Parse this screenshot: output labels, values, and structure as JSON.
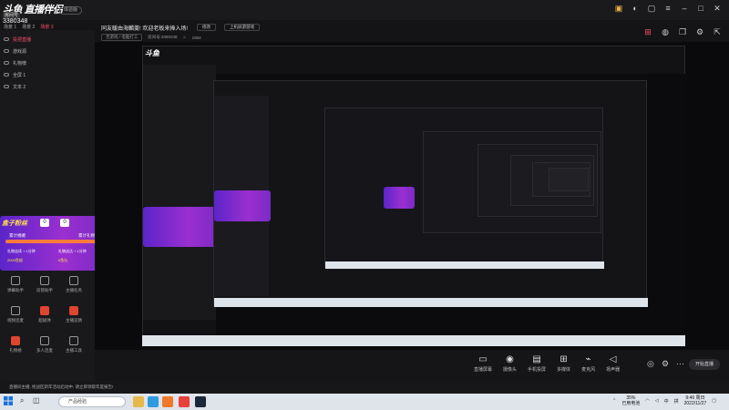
{
  "app": {
    "logo": "斗鱼 直播伴侣",
    "badge": "体验版",
    "room_id_tag": "房间号",
    "room_id": "3380348"
  },
  "scenes": [
    "场景 1",
    "场景 2",
    "场景 3"
  ],
  "active_scene": 2,
  "room": {
    "title": "同友暖由海麟羹! 欢迎老板来捧入场!",
    "edit_btn": "修改",
    "topic_btn": "上机屏游游戏",
    "category": "无游戏 / 电脑打工",
    "id_text": "房间号:3380348",
    "viewers": "1904"
  },
  "sources": [
    {
      "label": "投把直播"
    },
    {
      "label": "游戏源"
    },
    {
      "label": "礼物榜"
    },
    {
      "label": "全屏 1"
    },
    {
      "label": "文本 2"
    }
  ],
  "gift_card": {
    "title": "盒子粉丝",
    "gift_count": "0",
    "coin_count": "0",
    "left_label": "累计捐赠",
    "right_label": "累计礼物",
    "item1": "礼物连续 + 1分钟",
    "item2": "礼物送达 + 1分钟",
    "item1_val": "2000鱼翅",
    "item2_val": "6鱼丸"
  },
  "tools": [
    {
      "label": "弹幕助手",
      "red": false
    },
    {
      "label": "房管助手",
      "red": false
    },
    {
      "label": "主播任务",
      "red": false
    },
    {
      "label": "视频连麦",
      "red": false
    },
    {
      "label": "超级弹",
      "red": true
    },
    {
      "label": "主播竞猜",
      "red": true
    },
    {
      "label": "礼物榜",
      "red": true
    },
    {
      "label": "多人连麦",
      "red": false
    },
    {
      "label": "主播工具",
      "red": false
    }
  ],
  "bottom_tools": [
    {
      "icon": "▭",
      "label": "直播屏幕"
    },
    {
      "icon": "◉",
      "label": "摄像头"
    },
    {
      "icon": "▤",
      "label": "手机投屏"
    },
    {
      "icon": "⊞",
      "label": "多媒体"
    },
    {
      "icon": "⌁",
      "label": "麦克风"
    },
    {
      "icon": "◁",
      "label": "扬声器"
    }
  ],
  "live_button": "开始直播",
  "notice": "直播间主播, 抢战区新年活动启动中, 请立即领取年度报告!",
  "taskbar": {
    "search": "产品经验",
    "battery": "35%",
    "battery_sub": "已用电池",
    "lang": "中",
    "input": "拼",
    "time": "9:46 周日",
    "date": "2022/11/27"
  },
  "accent": "#ff4d6a",
  "gift_purple": "#7a2ac6"
}
